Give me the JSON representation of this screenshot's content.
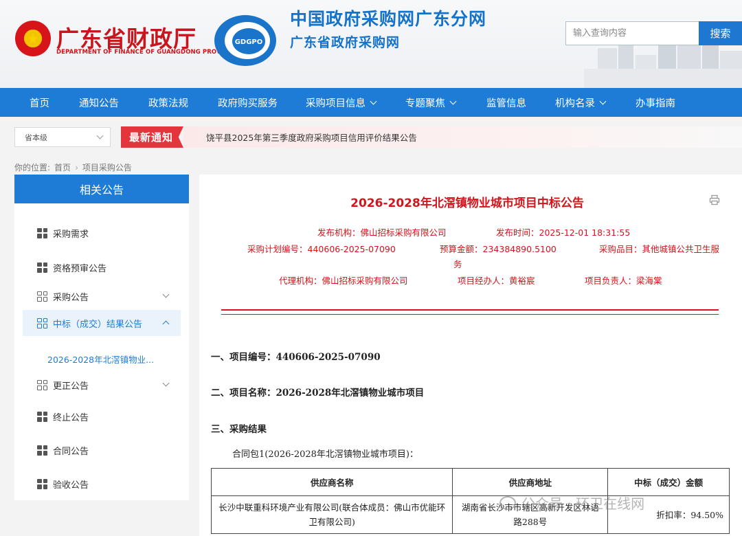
{
  "header": {
    "dept_cn": "广东省财政厅",
    "dept_en": "DEPARTMENT OF FINANCE OF GUANGDONG PROVINCE",
    "logo_text": "GDGPO",
    "site_title": "中国政府采购网广东分网",
    "site_subtitle": "广东省政府采购网",
    "search_placeholder": "输入查询内容",
    "search_button": "搜索"
  },
  "nav": [
    {
      "label": "首页",
      "caret": false
    },
    {
      "label": "通知公告",
      "caret": false
    },
    {
      "label": "政策法规",
      "caret": false
    },
    {
      "label": "政府购买服务",
      "caret": false
    },
    {
      "label": "采购项目信息",
      "caret": true
    },
    {
      "label": "专题聚焦",
      "caret": true
    },
    {
      "label": "监管信息",
      "caret": false
    },
    {
      "label": "机构名录",
      "caret": true
    },
    {
      "label": "办事指南",
      "caret": false
    }
  ],
  "notice": {
    "level_select": "省本级",
    "badge": "最新通知",
    "text": "饶平县2025年第三季度政府采购项目信用评价结果公告"
  },
  "breadcrumb": {
    "prefix": "你的位置:",
    "home": "首页",
    "current": "项目采购公告"
  },
  "sidebar": {
    "title": "相关公告",
    "items": [
      {
        "label": "采购需求"
      },
      {
        "label": "资格预审公告"
      },
      {
        "label": "采购公告"
      },
      {
        "label": "中标（成交）结果公告"
      },
      {
        "label": "更正公告"
      },
      {
        "label": "终止公告"
      },
      {
        "label": "合同公告"
      },
      {
        "label": "验收公告"
      }
    ],
    "active_sub": "2026-2028年北滘镇物业..."
  },
  "article": {
    "title": "2026-2028年北滘镇物业城市项目中标公告",
    "meta": {
      "publisher_k": "发布机构：",
      "publisher_v": "佛山招标采购有限公司",
      "time_k": "发布时间：",
      "time_v": "2025-12-01 18:31:55",
      "plan_k": "采购计划编号：",
      "plan_v": "440606-2025-07090",
      "budget_k": "预算金额：",
      "budget_v": "234384890.5100",
      "category_k": "采购品目：",
      "category_v": "其他城镇公共卫生服",
      "category_v2": "务",
      "agency_k": "代理机构：",
      "agency_v": "佛山招标采购有限公司",
      "handler_k": "项目经办人：",
      "handler_v": "黄裕宸",
      "leader_k": "项目负责人：",
      "leader_v": "梁海棠"
    },
    "sec1": "一、项目编号：440606-2025-07090",
    "sec2": "二、项目名称：2026-2028年北滘镇物业城市项目",
    "sec3": "三、采购结果",
    "package": "合同包1(2026-2028年北滘镇物业城市项目)：",
    "table": {
      "headers": [
        "供应商名称",
        "供应商地址",
        "中标（成交）金额"
      ],
      "row": {
        "name": "长沙中联重科环境产业有限公司(联合体成员：佛山市优能环卫有限公司)",
        "address": "湖南省长沙市市辖区高新开发区林语路288号",
        "amount": "折扣率：94.50%"
      }
    }
  },
  "watermark": "公众号 · 环卫在线网"
}
